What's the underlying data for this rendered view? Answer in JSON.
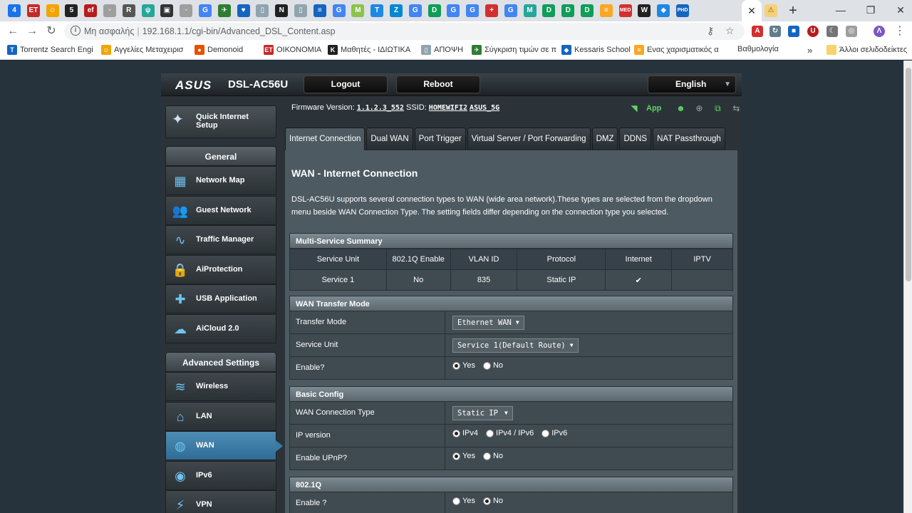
{
  "browser": {
    "tabs": [
      {
        "icon": "4",
        "color": "#1a73e8"
      },
      {
        "icon": "ET",
        "color": "#c62828"
      },
      {
        "icon": "☺",
        "color": "#f0a500"
      },
      {
        "icon": "5",
        "color": "#222222"
      },
      {
        "icon": "ef",
        "color": "#b71c1c"
      },
      {
        "icon": "◦",
        "color": "#9e9e9e"
      },
      {
        "icon": "R",
        "color": "#555555"
      },
      {
        "icon": "ψ",
        "color": "#26a69a"
      },
      {
        "icon": "▣",
        "color": "#333333"
      },
      {
        "icon": "◦",
        "color": "#9e9e9e"
      },
      {
        "icon": "G",
        "color": "#4285f4"
      },
      {
        "icon": "✈",
        "color": "#2e7d32"
      },
      {
        "icon": "♥",
        "color": "#1565c0"
      },
      {
        "icon": "▯",
        "color": "#90a4ae"
      },
      {
        "icon": "N",
        "color": "#212121"
      },
      {
        "icon": "▯",
        "color": "#90a4ae"
      },
      {
        "icon": "≡",
        "color": "#1565c0"
      },
      {
        "icon": "G",
        "color": "#4285f4"
      },
      {
        "icon": "M",
        "color": "#8bc34a"
      },
      {
        "icon": "T",
        "color": "#1e88e5"
      },
      {
        "icon": "Z",
        "color": "#0288d1"
      },
      {
        "icon": "G",
        "color": "#4285f4"
      },
      {
        "icon": "D",
        "color": "#0f9d58"
      },
      {
        "icon": "G",
        "color": "#4285f4"
      },
      {
        "icon": "G",
        "color": "#4285f4"
      },
      {
        "icon": "+",
        "color": "#d32f2f"
      },
      {
        "icon": "G",
        "color": "#4285f4"
      },
      {
        "icon": "M",
        "color": "#26a69a"
      },
      {
        "icon": "D",
        "color": "#0f9d58"
      },
      {
        "icon": "D",
        "color": "#0f9d58"
      },
      {
        "icon": "D",
        "color": "#0f9d58"
      },
      {
        "icon": "≡",
        "color": "#f9a825"
      },
      {
        "icon": "MED",
        "color": "#d32f2f"
      },
      {
        "icon": "W",
        "color": "#212121"
      },
      {
        "icon": "◆",
        "color": "#1e88e5"
      },
      {
        "icon": "PHD",
        "color": "#1565c0"
      }
    ],
    "active_tab_close": "✕",
    "extra_tab_icon": "⚠",
    "new_tab": "+",
    "window": {
      "minimize": "—",
      "maximize": "❐",
      "close": "✕"
    },
    "nav": {
      "back": "←",
      "forward": "→",
      "reload": "↻"
    },
    "security_label": "Μη ασφαλής",
    "url": "192.168.1.1/cgi-bin/Advanced_DSL_Content.asp",
    "key_icon": "⚷",
    "star_icon": "☆",
    "extensions": [
      {
        "icon": "A",
        "color": "#d32f2f"
      },
      {
        "icon": "↻",
        "color": "#607d8b"
      },
      {
        "icon": "■",
        "color": "#1565c0"
      },
      {
        "icon": "U",
        "color": "#b71c1c"
      },
      {
        "icon": "☾",
        "color": "#757575"
      },
      {
        "icon": "◎",
        "color": "#9e9e9e"
      },
      {
        "icon": "Λ",
        "color": "#7e57c2"
      }
    ],
    "menu_icon": "⋮",
    "bookmarks": [
      {
        "label": "Torrentz Search Engi",
        "icon": "T",
        "color": "#1565c0"
      },
      {
        "label": "Αγγελίες Μεταχειρισ",
        "icon": "☺",
        "color": "#f0a500"
      },
      {
        "label": "Demonoid",
        "icon": "●",
        "color": "#e65100"
      },
      {
        "label": "ΟΙΚΟΝΟΜΙΑ",
        "icon": "ET",
        "color": "#c62828"
      },
      {
        "label": "Μαθητές - ΙΔΙΩΤΙΚΑ",
        "icon": "K",
        "color": "#212121"
      },
      {
        "label": "ΑΠΟΨΗ",
        "icon": "▯",
        "color": "#90a4ae"
      },
      {
        "label": "Σύγκριση τιμών σε π",
        "icon": "✈",
        "color": "#2e7d32"
      },
      {
        "label": "Kessaris School",
        "icon": "◆",
        "color": "#1565c0"
      },
      {
        "label": "Ενας χαρισματικός α",
        "icon": "≡",
        "color": "#f9a825"
      },
      {
        "label": "Βαθμολογία",
        "icon": "",
        "color": "#ffffff"
      }
    ],
    "bookmarks_more": "»",
    "other_bookmarks": "Άλλοι σελιδοδείκτες"
  },
  "router": {
    "brand": "ASUS",
    "model": "DSL-AC56U",
    "logout": "Logout",
    "reboot": "Reboot",
    "language": "English",
    "firmware_label": "Firmware Version:",
    "firmware": "1.1.2.3_552",
    "ssid_label": "SSID:",
    "ssid1": "HOMEWIFI2",
    "ssid2": "ASUS_5G",
    "app_label": "App",
    "quick_setup": "Quick Internet Setup",
    "general_label": "General",
    "general_items": [
      {
        "label": "Network Map",
        "icon": "▦"
      },
      {
        "label": "Guest Network",
        "icon": "👥"
      },
      {
        "label": "Traffic Manager",
        "icon": "∿"
      },
      {
        "label": "AiProtection",
        "icon": "🔒"
      },
      {
        "label": "USB Application",
        "icon": "✚"
      },
      {
        "label": "AiCloud 2.0",
        "icon": "☁"
      }
    ],
    "advanced_label": "Advanced Settings",
    "advanced_items": [
      {
        "label": "Wireless",
        "icon": "≋"
      },
      {
        "label": "LAN",
        "icon": "⌂"
      },
      {
        "label": "WAN",
        "icon": "◍"
      },
      {
        "label": "IPv6",
        "icon": "◉"
      },
      {
        "label": "VPN",
        "icon": "⚡"
      }
    ],
    "tabs": [
      "Internet Connection",
      "Dual WAN",
      "Port Trigger",
      "Virtual Server / Port Forwarding",
      "DMZ",
      "DDNS",
      "NAT Passthrough"
    ],
    "page_title": "WAN - Internet Connection",
    "description": "DSL-AC56U supports several connection types to WAN (wide area network).These types are selected from the dropdown menu beside WAN Connection Type. The setting fields differ depending on the connection type you selected.",
    "summary": {
      "title": "Multi-Service Summary",
      "headers": [
        "Service Unit",
        "802.1Q Enable",
        "VLAN ID",
        "Protocol",
        "Internet",
        "IPTV"
      ],
      "row": [
        "Service 1",
        "No",
        "835",
        "Static IP",
        "✔",
        ""
      ]
    },
    "transfer": {
      "title": "WAN Transfer Mode",
      "transfer_mode_label": "Transfer Mode",
      "transfer_mode_value": "Ethernet WAN",
      "service_unit_label": "Service Unit",
      "service_unit_value": "Service 1(Default Route)",
      "enable_label": "Enable?",
      "yes": "Yes",
      "no": "No"
    },
    "basic": {
      "title": "Basic Config",
      "conn_type_label": "WAN Connection Type",
      "conn_type_value": "Static IP",
      "ipver_label": "IP version",
      "ipv4": "IPv4",
      "ipv4v6": "IPv4 / IPv6",
      "ipv6": "IPv6",
      "upnp_label": "Enable UPnP?",
      "yes": "Yes",
      "no": "No"
    },
    "dot1q": {
      "title": "802.1Q",
      "enable_label": "Enable ?",
      "yes": "Yes",
      "no": "No"
    }
  }
}
